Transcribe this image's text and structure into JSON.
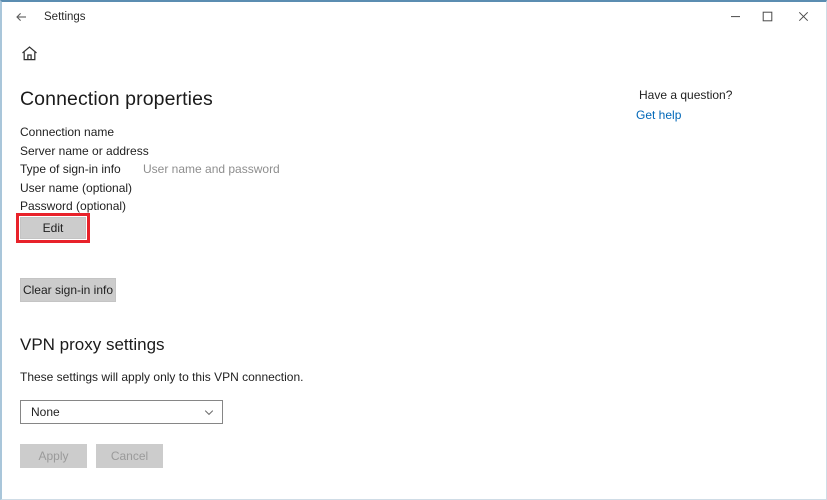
{
  "window": {
    "title": "Settings",
    "back_icon": "back-arrow-icon",
    "controls": {
      "minimize": "minimize-icon",
      "maximize": "maximize-icon",
      "close": "close-icon"
    },
    "accent_border": "#5b8db1"
  },
  "nav": {
    "home_icon": "home-icon"
  },
  "main": {
    "page_title": "Connection properties",
    "properties": [
      {
        "label": "Connection name",
        "value": ""
      },
      {
        "label": "Server name or address",
        "value": ""
      },
      {
        "label": "Type of sign-in info",
        "value": "User name and password"
      },
      {
        "label": "User name (optional)",
        "value": ""
      },
      {
        "label": "Password (optional)",
        "value": ""
      }
    ],
    "edit_button": "Edit",
    "clear_signin_button": "Clear sign-in info",
    "highlight_color": "#e8222a"
  },
  "proxy": {
    "section_title": "VPN proxy settings",
    "description": "These settings will apply only to this VPN connection.",
    "select": {
      "value": "None",
      "chevron_icon": "chevron-down-icon"
    }
  },
  "actions": {
    "apply_label": "Apply",
    "cancel_label": "Cancel"
  },
  "help": {
    "heading": "Have a question?",
    "link": "Get help",
    "link_color": "#0067b8"
  }
}
